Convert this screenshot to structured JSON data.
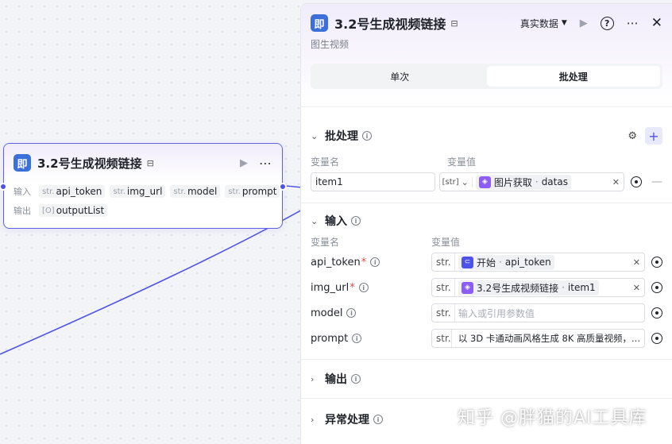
{
  "node": {
    "icon_label": "即",
    "title": "3.2号生成视频链接",
    "input_label": "输入",
    "output_label": "输出",
    "inputs": [
      {
        "type": "str.",
        "name": "api_token"
      },
      {
        "type": "str.",
        "name": "img_url"
      },
      {
        "type": "str.",
        "name": "model"
      },
      {
        "type": "str.",
        "name": "prompt"
      }
    ],
    "outputs": [
      {
        "type": "[O]",
        "name": "outputList"
      }
    ]
  },
  "panel": {
    "icon_label": "即",
    "title": "3.2号生成视频链接",
    "env_label": "真实数据",
    "subtitle": "图生视频",
    "tabs": [
      {
        "label": "单次",
        "active": false
      },
      {
        "label": "批处理",
        "active": true
      }
    ],
    "batch": {
      "title": "批处理",
      "col_name": "变量名",
      "col_value": "变量值",
      "row": {
        "name": "item1",
        "type": "[str]",
        "ref_source": "图片获取",
        "ref_sep": "·",
        "ref_field": "datas"
      }
    },
    "input": {
      "title": "输入",
      "col_name": "变量名",
      "col_value": "变量值",
      "params": [
        {
          "name": "api_token",
          "required": true,
          "type": "str.",
          "ref_source": "开始",
          "ref_sep": "·",
          "ref_field": "api_token",
          "icon": "blue"
        },
        {
          "name": "img_url",
          "required": true,
          "type": "str.",
          "ref_source": "3.2号生成视频链接",
          "ref_sep": "·",
          "ref_field": "item1",
          "icon": "purple"
        },
        {
          "name": "model",
          "required": false,
          "type": "str.",
          "placeholder": "输入或引用参数值"
        },
        {
          "name": "prompt",
          "required": false,
          "type": "str.",
          "value": "以 3D 卡通动画风格生成 8K 高质量视频，..."
        }
      ]
    },
    "output": {
      "title": "输出"
    },
    "error": {
      "title": "异常处理"
    }
  },
  "watermark": "知乎 @胖猫的AI工具库",
  "colors": {
    "accent": "#4d53e8",
    "node_border": "#5b62e6",
    "app_icon": "#3d6fd9",
    "purple_icon": "#8b5cf6"
  }
}
